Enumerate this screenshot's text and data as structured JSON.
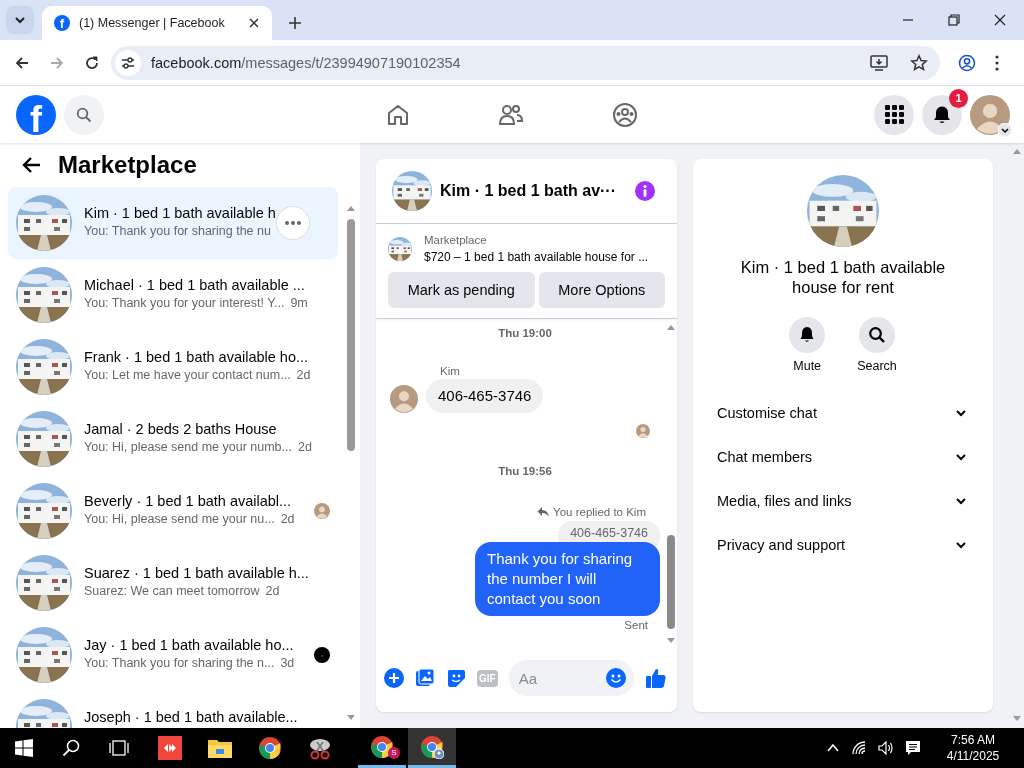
{
  "browser": {
    "tab_title": "(1) Messenger | Facebook",
    "favicon": "f",
    "url_host": "facebook.com",
    "url_path": "/messages/t/23994907190102354"
  },
  "header": {
    "logo": "f",
    "notification_badge": "1"
  },
  "sidebar": {
    "title": "Marketplace",
    "conversations": [
      {
        "title": "Kim · 1 bed 1 bath available h",
        "preview": "You: Thank you for sharing the nu",
        "kind": "plain",
        "selected": true
      },
      {
        "title": "Michael · 1 bed 1 bath available ...",
        "preview": "You: Thank you for your interest! Y...",
        "time": "9m",
        "kind": "plain",
        "selected": false
      },
      {
        "title": "Frank · 1 bed 1 bath available ho...",
        "preview": "You: Let me have your contact num...",
        "time": "2d",
        "kind": "plain",
        "selected": false
      },
      {
        "title": "Jamal · 2 beds 2 baths House",
        "preview": "You: Hi, please send me your numb...",
        "time": "2d",
        "kind": "plain",
        "selected": false
      },
      {
        "title": "Beverly · 1 bed 1 bath availabl...",
        "preview": "You: Hi, please send me your nu...",
        "time": "2d",
        "kind": "seen_avatar",
        "selected": false
      },
      {
        "title": "Suarez · 1 bed 1 bath available h...",
        "preview": "Suarez: We can meet tomorrow",
        "time": "2d",
        "kind": "plain",
        "selected": false
      },
      {
        "title": "Jay · 1 bed 1 bath available ho...",
        "preview": "You: Thank you for sharing the n...",
        "time": "3d",
        "kind": "seen_dot",
        "selected": false
      },
      {
        "title": "Joseph · 1 bed 1 bath available...",
        "kind": "plain",
        "selected": false
      }
    ]
  },
  "chat": {
    "title": "Kim · 1 bed 1 bath av···",
    "listing_label": "Marketplace",
    "listing_title": "$720 – 1 bed 1 bath available house for ...",
    "actions": [
      "Mark as pending",
      "More Options"
    ],
    "messages": [
      {
        "kind": "timestamp",
        "text": "Thu 19:00"
      },
      {
        "kind": "incoming",
        "sender": "Kim",
        "text": "406-465-3746"
      },
      {
        "kind": "read_receipt"
      },
      {
        "kind": "timestamp",
        "text": "Thu 19:56"
      },
      {
        "kind": "outgoing",
        "reply_note": "You replied to Kim",
        "quoted": "406-465-3746",
        "text": "Thank you for sharing the number I will contact you soon",
        "status": "Sent"
      }
    ],
    "composer": {
      "gif_label": "GIF",
      "placeholder": "Aa"
    }
  },
  "details": {
    "title": "Kim · 1 bed 1 bath available house for rent",
    "actions": [
      {
        "kind": "mute",
        "label": "Mute"
      },
      {
        "kind": "search",
        "label": "Search"
      }
    ],
    "sections": [
      {
        "label": "Customise chat",
        "expanded": false
      },
      {
        "label": "Chat members",
        "expanded": false
      },
      {
        "label": "Media, files and links",
        "expanded": false
      },
      {
        "label": "Privacy and support",
        "expanded": false
      }
    ]
  },
  "taskbar": {
    "profile_letter": "S",
    "time": "7:56 AM",
    "date": "4/11/2025"
  }
}
